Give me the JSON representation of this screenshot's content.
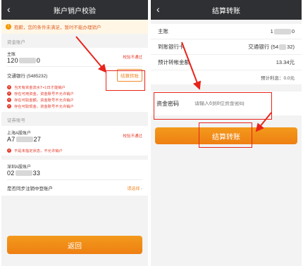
{
  "left": {
    "title": "账户销户校验",
    "warning": "抱歉，您的条件未满足，暂时不能办理销户",
    "fund_section": "资金账户",
    "main_label": "主账",
    "main_prefix": "120",
    "main_suffix": "0",
    "main_status": "校验不通过",
    "bank_label": "交通银行 (5485232)",
    "transfer_btn": "结算转账",
    "errors": [
      "当天有资金流水T+1日才能销户",
      "存在可用资金，资金账号不允许销户",
      "存在可取金额，资金账号不允许销户",
      "存在可取现金，资金账号不允许销户"
    ],
    "securities_section": "证券账号",
    "sh_label": "上海A股账户",
    "sh_prefix": "A7",
    "sh_suffix": "27",
    "sh_status": "校验不通过",
    "sh_error": "不是未指定状态，不允许销户",
    "sz_label": "深圳A股账户",
    "sz_prefix": "02",
    "sz_suffix": "33",
    "sync_label": "是否同步注销中登账户",
    "sync_value": "请选择",
    "back_btn": "返回"
  },
  "right": {
    "title": "结算转账",
    "rows": [
      {
        "label": "主账",
        "prefix": "1",
        "suffix": "0"
      },
      {
        "label": "到账银行卡",
        "prefix": "交通银行 (54",
        "suffix": "32)"
      },
      {
        "label": "预计转帐金额",
        "value": "13.34元"
      }
    ],
    "interest": "预计利息：0.0元",
    "password_label": "资金密码",
    "password_placeholder": "请输入6到8位资金密码",
    "submit_btn": "结算转账"
  },
  "colors": {
    "accent": "#f08a2c",
    "error": "#e43a2b",
    "navbar": "#2f3033",
    "annotation": "#e8231b"
  }
}
